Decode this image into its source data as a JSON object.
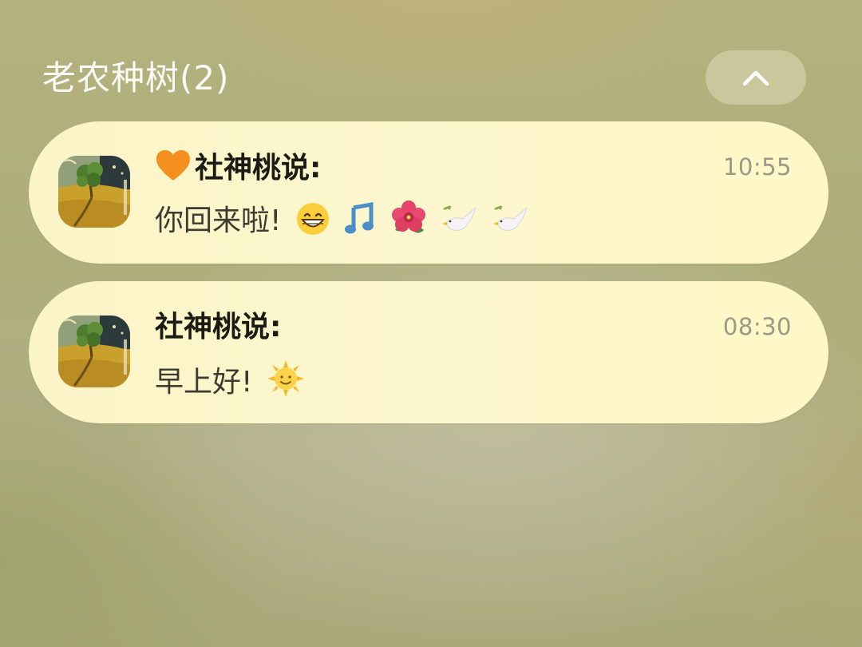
{
  "group": {
    "title": "老农种树(2)",
    "collapse_icon": "chevron-up-icon"
  },
  "notifications": [
    {
      "app_icon": "tree-landscape-app-icon",
      "sender_prefix_icon": "orange-heart-emoji",
      "sender": "社神桃说:",
      "time": "10:55",
      "message": "你回来啦!",
      "emojis": [
        "grinning-face-emoji",
        "musical-note-emoji",
        "hibiscus-emoji",
        "dove-emoji",
        "dove-emoji"
      ]
    },
    {
      "app_icon": "tree-landscape-app-icon",
      "sender": "社神桃说:",
      "time": "08:30",
      "message": "早上好!",
      "emojis": [
        "sun-with-face-emoji"
      ]
    }
  ],
  "colors": {
    "card_background": "#fdf7cf",
    "sender_text": "#1b1b14",
    "message_text": "#3d3b32",
    "time_text": "#9b9886",
    "title_text": "#ffffff"
  }
}
